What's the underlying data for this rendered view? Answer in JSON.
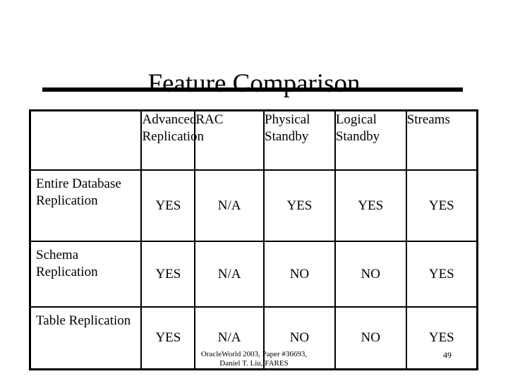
{
  "slide": {
    "title": "Feature Comparison",
    "page_number": "49"
  },
  "table": {
    "corner_label": "",
    "columns": [
      {
        "label": "Advanced Replication"
      },
      {
        "label": "RAC"
      },
      {
        "label": "Physical Standby"
      },
      {
        "label": "Logical Standby"
      },
      {
        "label": "Streams"
      }
    ],
    "rows": [
      {
        "label": "Entire Database Replication",
        "values": [
          "YES",
          "N/A",
          "YES",
          "YES",
          "YES"
        ]
      },
      {
        "label": "Schema Replication",
        "values": [
          "YES",
          "N/A",
          "NO",
          "NO",
          "YES"
        ]
      },
      {
        "label": "Table Replication",
        "values": [
          "YES",
          "N/A",
          "NO",
          "NO",
          "YES"
        ]
      }
    ]
  },
  "footer": {
    "line1": "OracleWorld 2003, Paper #36693,",
    "line2": "Daniel T. Liu, FARES"
  },
  "colors": {
    "text": "#000000",
    "background": "#ffffff",
    "rule": "#000000"
  }
}
